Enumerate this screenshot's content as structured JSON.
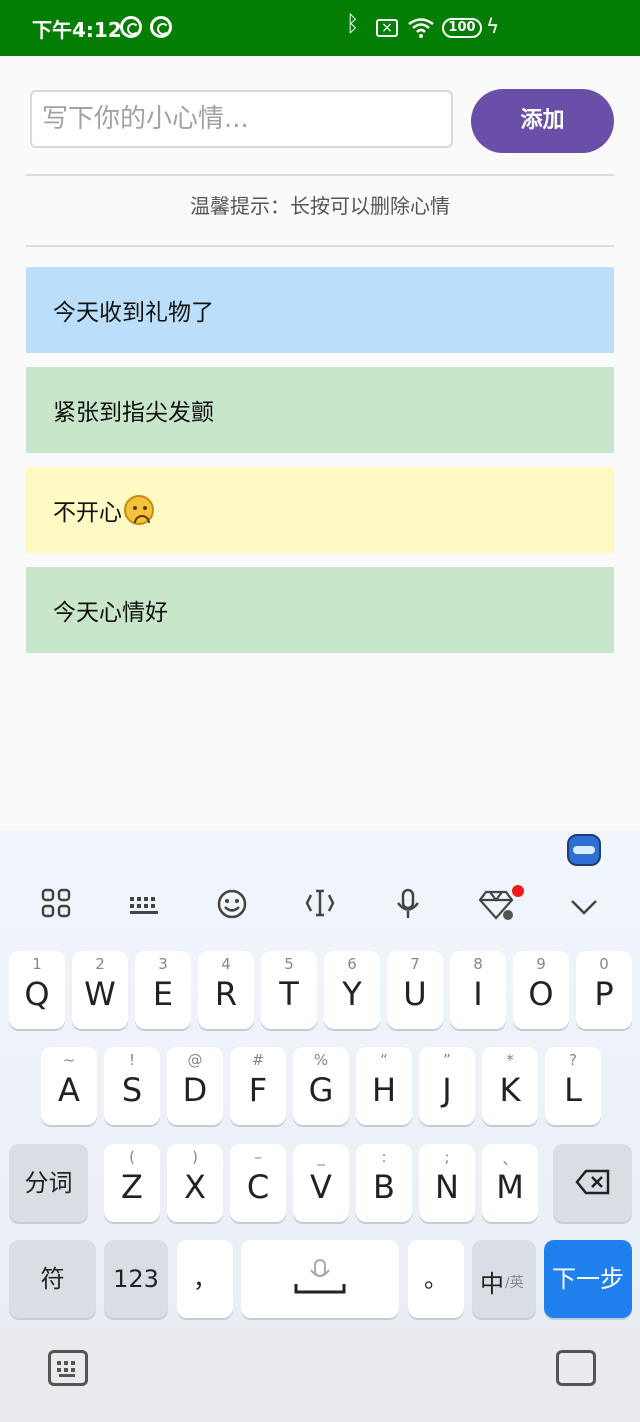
{
  "status_bar": {
    "time": "下午4:12",
    "battery": "100",
    "icons": [
      "notification-ring-icon",
      "notification-ring-icon",
      "bluetooth-icon",
      "no-sim-icon",
      "wifi-icon",
      "battery-icon",
      "charging-icon"
    ]
  },
  "composer": {
    "placeholder": "写下你的小心情...",
    "value": "",
    "add_label": "添加"
  },
  "hint": "温馨提示：长按可以删除心情",
  "moods": [
    {
      "text": "今天收到礼物了",
      "color": "#bbdefb"
    },
    {
      "text": "紧张到指尖发颤",
      "color": "#c8e6c9"
    },
    {
      "text": "不开心",
      "color": "#fff9c4",
      "emoji": "slightly-frowning-face-icon"
    },
    {
      "text": "今天心情好",
      "color": "#c8e6c9"
    }
  ],
  "keyboard": {
    "toolbar": [
      "apps-grid-icon",
      "keyboard-icon",
      "emoji-icon",
      "text-cursor-icon",
      "microphone-icon",
      "diamond-icon",
      "chevron-down-icon"
    ],
    "row1": [
      {
        "sub": "1",
        "main": "Q"
      },
      {
        "sub": "2",
        "main": "W"
      },
      {
        "sub": "3",
        "main": "E"
      },
      {
        "sub": "4",
        "main": "R"
      },
      {
        "sub": "5",
        "main": "T"
      },
      {
        "sub": "6",
        "main": "Y"
      },
      {
        "sub": "7",
        "main": "U"
      },
      {
        "sub": "8",
        "main": "I"
      },
      {
        "sub": "9",
        "main": "O"
      },
      {
        "sub": "0",
        "main": "P"
      }
    ],
    "row2": [
      {
        "sub": "~",
        "main": "A"
      },
      {
        "sub": "!",
        "main": "S"
      },
      {
        "sub": "@",
        "main": "D"
      },
      {
        "sub": "#",
        "main": "F"
      },
      {
        "sub": "%",
        "main": "G"
      },
      {
        "sub": "“",
        "main": "H"
      },
      {
        "sub": "”",
        "main": "J"
      },
      {
        "sub": "*",
        "main": "K"
      },
      {
        "sub": "?",
        "main": "L"
      }
    ],
    "row3": [
      {
        "sub": "(",
        "main": "Z"
      },
      {
        "sub": ")",
        "main": "X"
      },
      {
        "sub": "–",
        "main": "C"
      },
      {
        "sub": "_",
        "main": "V"
      },
      {
        "sub": ":",
        "main": "B"
      },
      {
        "sub": ";",
        "main": "N"
      },
      {
        "sub": "、",
        "main": "M"
      }
    ],
    "segment_label": "分词",
    "symbol_label": "符",
    "number_label": "123",
    "comma_label": "，",
    "period_label": "。",
    "lang_main": "中",
    "lang_sub": "/英",
    "next_label": "下一步"
  },
  "nav_icons": [
    "keyboard-switch-icon",
    "clipboard-icon"
  ]
}
